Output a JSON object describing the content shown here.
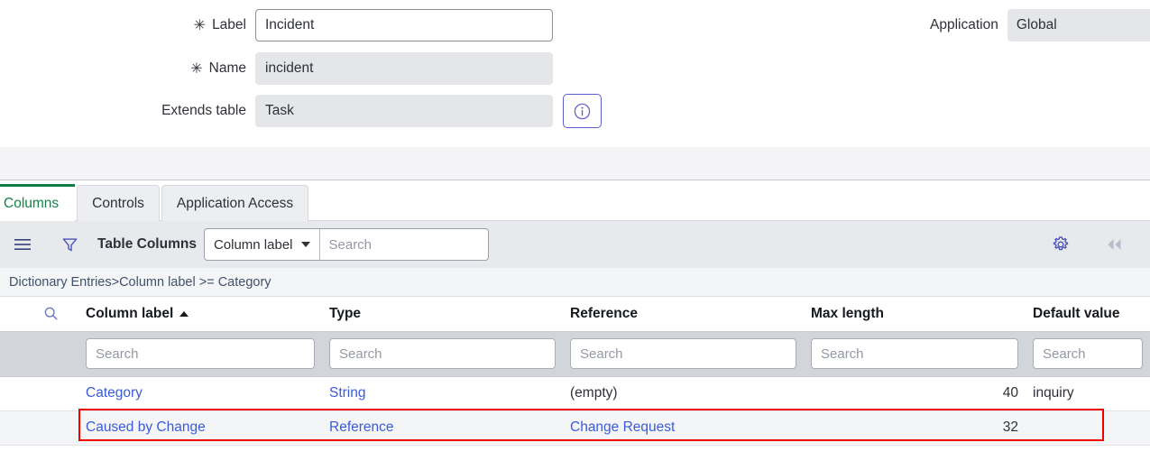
{
  "form": {
    "fields": [
      {
        "label": "Label",
        "required": true,
        "value": "Incident",
        "editable": true
      },
      {
        "label": "Name",
        "required": true,
        "value": "incident",
        "editable": false
      },
      {
        "label": "Extends table",
        "required": false,
        "value": "Task",
        "editable": false
      }
    ],
    "info_icon": "info-circle-icon",
    "application": {
      "label": "Application",
      "value": "Global"
    },
    "required_marker": "✳"
  },
  "tabs": [
    {
      "label": "Columns",
      "active": true
    },
    {
      "label": "Controls",
      "active": false
    },
    {
      "label": "Application Access",
      "active": false
    }
  ],
  "toolbar": {
    "menu_icon": "hamburger-menu-icon",
    "filter_icon": "funnel-filter-icon",
    "title": "Table Columns",
    "search_field": "Column label",
    "search_placeholder": "Search",
    "gear_icon": "gear-icon",
    "collapse_icon": "double-chevron-left-icon"
  },
  "breadcrumb": "Dictionary Entries>Column label >= Category",
  "table": {
    "search_icon": "search-icon",
    "sort_indicator": "ascending",
    "columns": [
      {
        "label": "Column label",
        "sorted": true,
        "align": "left"
      },
      {
        "label": "Type",
        "sorted": false,
        "align": "left"
      },
      {
        "label": "Reference",
        "sorted": false,
        "align": "left"
      },
      {
        "label": "Max length",
        "sorted": false,
        "align": "right"
      },
      {
        "label": "Default value",
        "sorted": false,
        "align": "left"
      }
    ],
    "filter_placeholder": "Search",
    "rows": [
      {
        "column_label": "Category",
        "type": "String",
        "reference": "(empty)",
        "max_length": "40",
        "default_value": "inquiry",
        "highlighted": true,
        "reference_is_link": false,
        "default_is_link": false
      },
      {
        "column_label": "Caused by Change",
        "type": "Reference",
        "reference": "Change Request",
        "max_length": "32",
        "default_value": "",
        "highlighted": false,
        "reference_is_link": true,
        "default_is_link": false
      }
    ]
  },
  "colors": {
    "accent_green": "#0f7b45",
    "link_blue": "#3b5bdb",
    "highlight_red": "#ee0000",
    "toolbar_bg": "#e8e9ed",
    "filter_row_bg": "#d2d5da"
  }
}
